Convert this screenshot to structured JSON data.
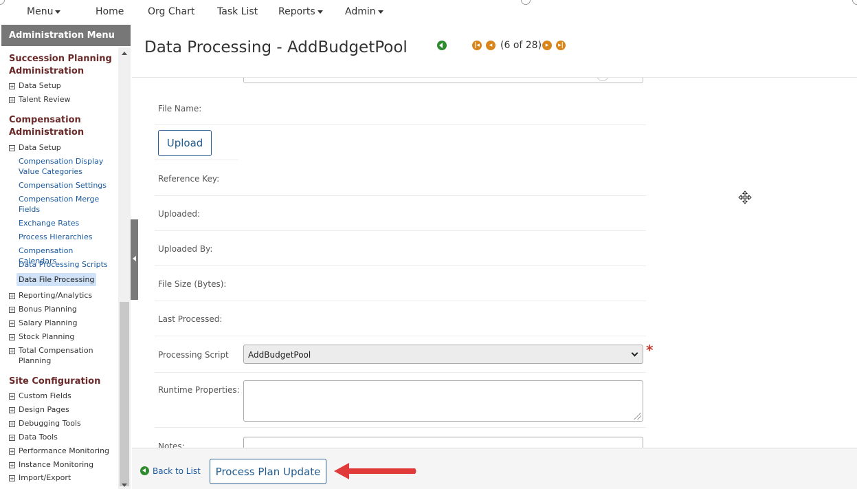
{
  "nav": {
    "menu": "Menu",
    "home": "Home",
    "org_chart": "Org Chart",
    "task_list": "Task List",
    "reports": "Reports",
    "admin": "Admin"
  },
  "sidebar": {
    "header": "Administration Menu",
    "sections": [
      {
        "title": "Succession Planning Administration",
        "items": [
          "Data Setup",
          "Talent Review"
        ]
      },
      {
        "title": "Compensation Administration",
        "data_setup": "Data Setup",
        "sub_items": [
          "Compensation Display Value Categories",
          "Compensation Settings",
          "Compensation Merge Fields",
          "Exchange Rates",
          "Process Hierarchies",
          "Compensation Calendars",
          "Data Processing Scripts",
          "Data File Processing"
        ],
        "items": [
          "Reporting/Analytics",
          "Bonus Planning",
          "Salary Planning",
          "Stock Planning",
          "Total Compensation Planning"
        ]
      },
      {
        "title": "Site Configuration",
        "items": [
          "Custom Fields",
          "Design Pages",
          "Debugging Tools",
          "Data Tools",
          "Performance Monitoring",
          "Instance Monitoring",
          "Import/Export"
        ]
      }
    ]
  },
  "page": {
    "title": "Data Processing - AddBudgetPool",
    "pager": "(6 of 28)"
  },
  "form": {
    "file_name_label": "File Name:",
    "upload_button": "Upload",
    "reference_key_label": "Reference Key:",
    "uploaded_label": "Uploaded:",
    "uploaded_by_label": "Uploaded By:",
    "file_size_label": "File Size (Bytes):",
    "last_processed_label": "Last Processed:",
    "processing_script_label": "Processing Script",
    "processing_script_value": "AddBudgetPool",
    "required_marker": "*",
    "runtime_properties_label": "Runtime Properties:",
    "notes_label": "Notes:"
  },
  "footer": {
    "back_to_list": "Back to List",
    "process_button": "Process Plan Update"
  },
  "colors": {
    "accent": "#1f5a8e",
    "section_title": "#6b2a2a",
    "link": "#1a5aa0",
    "pager_button": "#d9851a",
    "back_icon": "#2e8b2e",
    "annotation_arrow": "#e03a3a"
  }
}
